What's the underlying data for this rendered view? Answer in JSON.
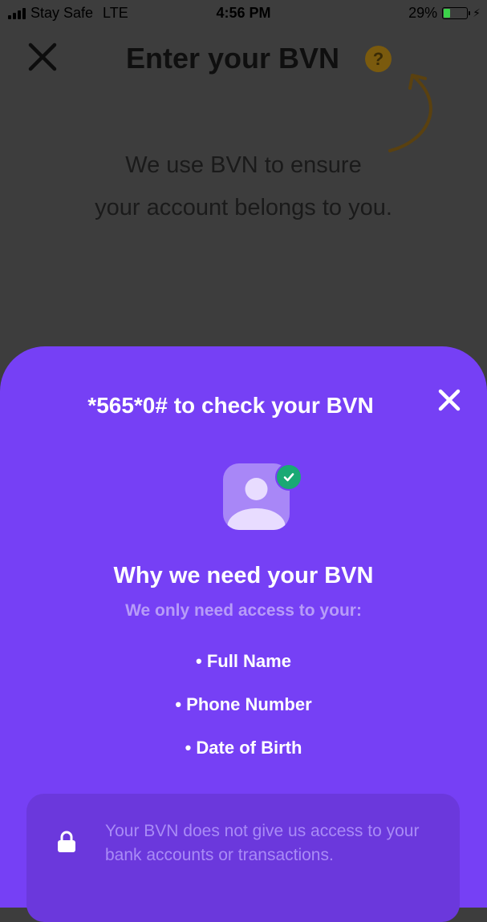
{
  "status_bar": {
    "carrier": "Stay Safe",
    "network": "LTE",
    "time": "4:56 PM",
    "battery_percent": "29%",
    "battery_level": 0.29,
    "battery_color": "#3cd24a"
  },
  "header": {
    "title": "Enter your BVN",
    "close_icon": "close-icon",
    "help_icon_glyph": "?"
  },
  "intro": {
    "line1": "We use BVN to ensure",
    "line2": "your account belongs to you."
  },
  "sheet": {
    "background": "#7640f5",
    "title": "*565*0# to check your BVN",
    "why_title": "Why we need your BVN",
    "why_subtitle": "We only need access to your:",
    "items": [
      "• Full Name",
      "• Phone Number",
      "• Date of Birth"
    ],
    "notice": "Your BVN does not give us access to your bank accounts or transactions."
  }
}
